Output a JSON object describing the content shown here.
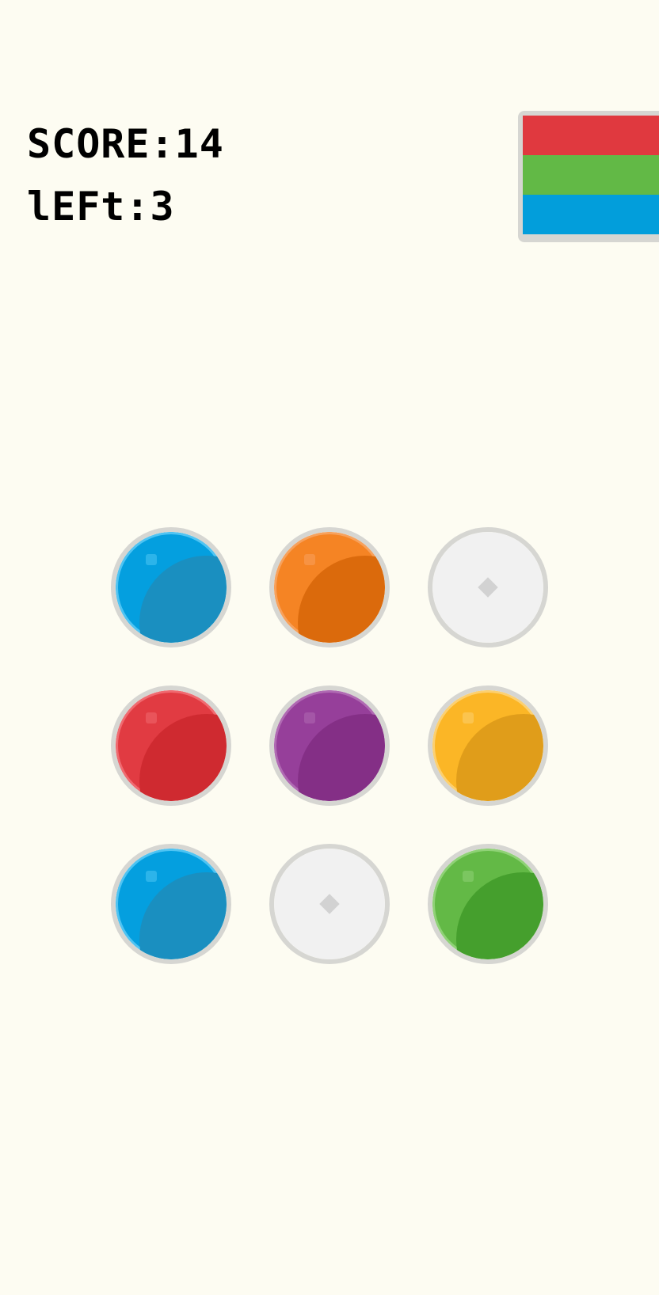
{
  "hud": {
    "score_label": "SCORE:14",
    "left_label": "lEFt:3"
  },
  "next_piece": {
    "bars": [
      {
        "color": "#e0393f",
        "edge": "#c9262c"
      },
      {
        "color": "#62b946",
        "edge": "#45a02e"
      },
      {
        "color": "#029edb",
        "edge": "#1a8fc0"
      }
    ]
  },
  "board": {
    "cells": [
      {
        "state": "filled",
        "color": "blue"
      },
      {
        "state": "filled",
        "color": "orange"
      },
      {
        "state": "empty"
      },
      {
        "state": "filled",
        "color": "red"
      },
      {
        "state": "filled",
        "color": "purple"
      },
      {
        "state": "filled",
        "color": "yellow"
      },
      {
        "state": "filled",
        "color": "blue"
      },
      {
        "state": "empty"
      },
      {
        "state": "filled",
        "color": "green"
      }
    ]
  },
  "palette": {
    "blue": {
      "base": "#049fdf",
      "shade": "#1a8fc0",
      "rim": "#4fc4f3"
    },
    "orange": {
      "base": "#f58424",
      "shade": "#db6a0c",
      "rim": "#f7a15c"
    },
    "red": {
      "base": "#e13b42",
      "shade": "#cf2a30",
      "rim": "#f06a70"
    },
    "purple": {
      "base": "#963f9a",
      "shade": "#842f86",
      "rim": "#b06ab3"
    },
    "yellow": {
      "base": "#fbb626",
      "shade": "#e09d1a",
      "rim": "#fcd070"
    },
    "green": {
      "base": "#63b946",
      "shade": "#459f2d",
      "rim": "#8fd276"
    }
  }
}
